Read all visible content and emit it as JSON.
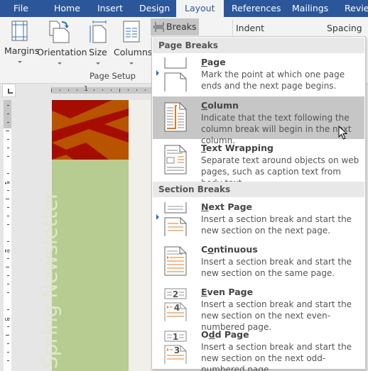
{
  "tabs": [
    {
      "label": "File",
      "active": false
    },
    {
      "label": "Home",
      "active": false
    },
    {
      "label": "Insert",
      "active": false
    },
    {
      "label": "Design",
      "active": false
    },
    {
      "label": "Layout",
      "active": true
    },
    {
      "label": "References",
      "active": false
    },
    {
      "label": "Mailings",
      "active": false
    },
    {
      "label": "Review",
      "active": false
    }
  ],
  "ribbon": {
    "buttons": [
      {
        "label": "Margins",
        "icon": "margins-icon"
      },
      {
        "label": "Orientation",
        "icon": "orientation-icon"
      },
      {
        "label": "Size",
        "icon": "size-icon"
      },
      {
        "label": "Columns",
        "icon": "columns-icon"
      }
    ],
    "group_label": "Page Setup",
    "breaks_label": "Breaks",
    "indent_label": "Indent",
    "spacing_label": "Spacing"
  },
  "ruler": {
    "h_numbers": [
      "1"
    ],
    "v_numbers": [
      "1",
      "2",
      "3"
    ]
  },
  "document": {
    "vertical_title": "Spring Newsletter",
    "banner_color": "#a50d00",
    "banner_stripe_color": "#b85300",
    "sidebar_color": "#b7cc91"
  },
  "menu": {
    "sections": [
      {
        "header": "Page Breaks",
        "items": [
          {
            "key": "P",
            "rest": "age",
            "title": "Page",
            "description": "Mark the point at which one page ends and the next page begins.",
            "icon": "page-break-icon",
            "hover": false
          },
          {
            "key": "C",
            "rest": "olumn",
            "title": "Column",
            "description": "Indicate that the text following the column break will begin in the next column.",
            "icon": "column-break-icon",
            "hover": true
          },
          {
            "key": "T",
            "rest": "ext Wrapping",
            "title": "Text Wrapping",
            "description": "Separate text around objects on web pages, such as caption text from body text.",
            "icon": "text-wrapping-icon",
            "hover": false
          }
        ]
      },
      {
        "header": "Section Breaks",
        "items": [
          {
            "key": "N",
            "rest": "ext Page",
            "title": "Next Page",
            "description": "Insert a section break and start the new section on the next page.",
            "icon": "next-page-icon",
            "hover": false
          },
          {
            "pre": "C",
            "key": "o",
            "rest": "ntinuous",
            "title": "Continuous",
            "description": "Insert a section break and start the new section on the same page.",
            "icon": "continuous-icon",
            "hover": false
          },
          {
            "key": "E",
            "rest": "ven Page",
            "title": "Even Page",
            "description": "Insert a section break and start the new section on the next even-numbered page.",
            "icon": "even-page-icon",
            "hover": false,
            "numbers": [
              "2",
              "4"
            ]
          },
          {
            "pre": "O",
            "key": "d",
            "rest": "d Page",
            "title": "Odd Page",
            "description": "Insert a section break and start the new section on the next odd-numbered page.",
            "icon": "odd-page-icon",
            "hover": false,
            "numbers": [
              "1",
              "3"
            ]
          }
        ]
      }
    ]
  },
  "colors": {
    "accent": "#2b579a",
    "hover": "#c6c6c6",
    "orange": "#e07b20"
  }
}
